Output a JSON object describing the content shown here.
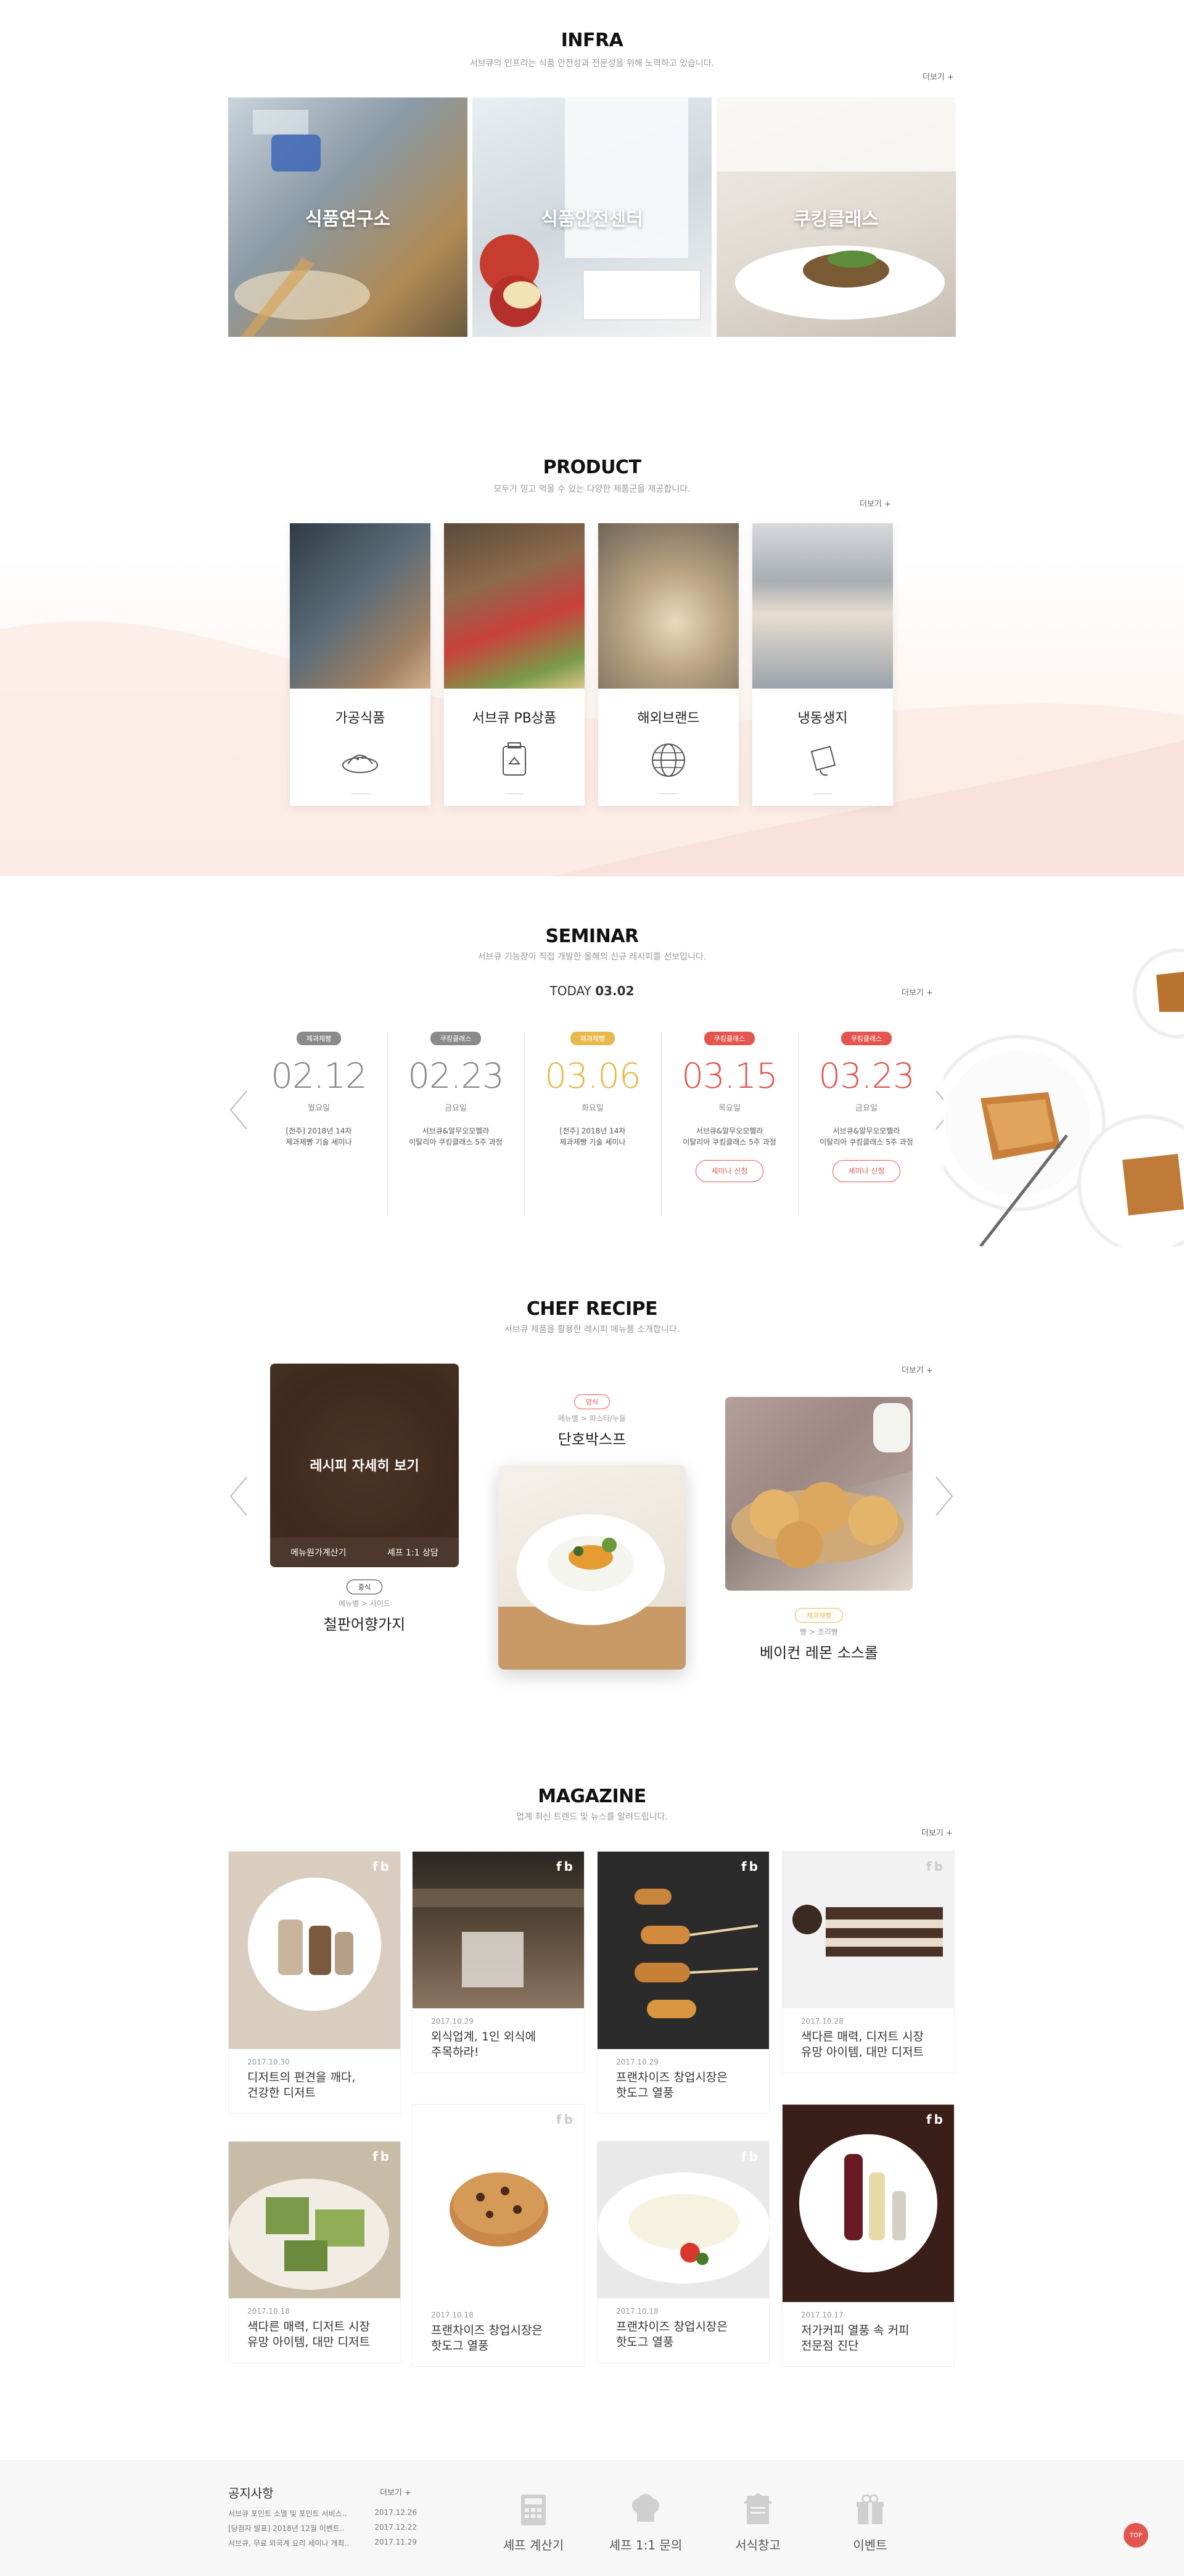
{
  "infra": {
    "title": "INFRA",
    "subtitle": "서브큐의 인프라는 식품 안전성과 전문성을 위해 노력하고 있습니다.",
    "more": "더보기 +",
    "cards": [
      {
        "label": "식품연구소"
      },
      {
        "label": "식품안전센터"
      },
      {
        "label": "쿠킹클래스"
      }
    ]
  },
  "product": {
    "title": "PRODUCT",
    "subtitle": "모두가 믿고 먹을 수 있는 다양한 제품군을 제공합니다.",
    "more": "더보기 +",
    "cards": [
      {
        "label": "가공식품",
        "icon": "processed-food-icon"
      },
      {
        "label": "서브큐 PB상품",
        "icon": "pb-product-icon"
      },
      {
        "label": "해외브랜드",
        "icon": "globe-icon"
      },
      {
        "label": "냉동생지",
        "icon": "frozen-dough-icon"
      }
    ]
  },
  "seminar": {
    "title": "SEMINAR",
    "subtitle": "서브큐 기능장이 직접 개발한 올해의 신규 레시피를 선보입니다.",
    "today_label": "TODAY",
    "today_date": "03.02",
    "more": "더보기 +",
    "items": [
      {
        "tag": "제과제빵",
        "date": "02.12",
        "day": "월요일",
        "desc1": "[전주] 2018년 14차",
        "desc2": "제과제빵 기술 세미나",
        "btn": ""
      },
      {
        "tag": "쿠킹클래스",
        "date": "02.23",
        "day": "금요일",
        "desc1": "서브큐&알무오모펠라",
        "desc2": "이탈리아 쿠킹클래스 5주 과정",
        "btn": ""
      },
      {
        "tag": "제과제빵",
        "date": "03.06",
        "day": "화요일",
        "desc1": "[전주] 2018년 14차",
        "desc2": "제과제빵 기술 세미나",
        "btn": ""
      },
      {
        "tag": "쿠킹클래스",
        "date": "03.15",
        "day": "목요일",
        "desc1": "서브큐&알무오모펠라",
        "desc2": "이탈리아 쿠킹클래스 5주 과정",
        "btn": "세미나 신청"
      },
      {
        "tag": "쿠킹클래스",
        "date": "03.23",
        "day": "금요일",
        "desc1": "서브큐&알무오모펠라",
        "desc2": "이탈리아 쿠킹클래스 5주 과정",
        "btn": "세미나 신청"
      }
    ],
    "colors": {
      "past": "#999999",
      "mid": "#e7b84a",
      "upcoming": "#e4554f"
    }
  },
  "recipe": {
    "title": "CHEF RECIPE",
    "subtitle": "서브큐 제품을 활용한 레시피 메뉴를 소개합니다.",
    "more": "더보기 +",
    "overlay_text": "레시피 자세히 보기",
    "overlay_left": "메뉴원가계산기",
    "overlay_right": "셰프 1:1 상담",
    "items": [
      {
        "tag": "중식",
        "cat": "메뉴별 > 사이드",
        "name": "철판어향가지"
      },
      {
        "tag": "양식",
        "cat": "메뉴별 > 파스타/누들",
        "name": "단호박스프"
      },
      {
        "tag": "제과제빵",
        "cat": "빵 > 조리빵",
        "name": "베이컨 레몬 소스롤"
      }
    ]
  },
  "magazine": {
    "title": "MAGAZINE",
    "subtitle": "업계 최신 트렌드 및 뉴스를 알려드립니다.",
    "more": "더보기 +",
    "fb_mark": "fb",
    "items": [
      {
        "date": "2017.10.30",
        "line1": "디저트의 편견을 깨다,",
        "line2": "건강한 디저트"
      },
      {
        "date": "2017.10.29",
        "line1": "외식업계, 1인 외식에",
        "line2": "주목하라!"
      },
      {
        "date": "2017.10.29",
        "line1": "프랜차이즈 창업시장은",
        "line2": "핫도그 열풍"
      },
      {
        "date": "2017.10.28",
        "line1": "색다른 매력, 디저트 시장",
        "line2": "유망 아이템, 대만 디저트"
      },
      {
        "date": "2017.10.18",
        "line1": "색다른 매력, 디저트 시장",
        "line2": "유망 아이템, 대만 디저트"
      },
      {
        "date": "2017.10.18",
        "line1": "프랜차이즈 창업시장은",
        "line2": "핫도그 열풍"
      },
      {
        "date": "2017.10.18",
        "line1": "프랜차이즈 창업시장은",
        "line2": "핫도그 열풍"
      },
      {
        "date": "2017.10.17",
        "line1": "저가커피 열풍 속 커피",
        "line2": "전문점 진단"
      }
    ]
  },
  "footer": {
    "notice_title": "공지사항",
    "notice_more": "더보기 +",
    "notices": [
      {
        "text": "서브큐 포인트 소멸 및 포인트 서비스..",
        "date": "2017.12.26"
      },
      {
        "text": "[당첨자 발표] 2018년 12월 이벤트..",
        "date": "2017.12.22"
      },
      {
        "text": "서브큐, 무료 외국계 요리 세미나 개최..",
        "date": "2017.11.29"
      }
    ],
    "quick": [
      {
        "label": "셰프 계산기",
        "icon": "calculator-icon"
      },
      {
        "label": "셰프 1:1 문의",
        "icon": "chef-hat-icon"
      },
      {
        "label": "서식창고",
        "icon": "document-icon"
      },
      {
        "label": "이벤트",
        "icon": "gift-icon"
      }
    ],
    "top_label": "TOP"
  }
}
